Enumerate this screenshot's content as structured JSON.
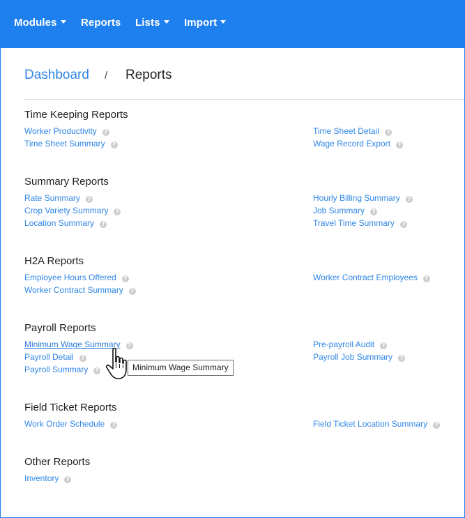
{
  "navbar": {
    "items": [
      {
        "label": "Modules",
        "dropdown": true
      },
      {
        "label": "Reports",
        "dropdown": false
      },
      {
        "label": "Lists",
        "dropdown": true
      },
      {
        "label": "Import",
        "dropdown": true
      }
    ]
  },
  "breadcrumb": {
    "home": "Dashboard",
    "separator": "/",
    "current": "Reports"
  },
  "sections": [
    {
      "title": "Time Keeping Reports",
      "left": [
        "Worker Productivity",
        "Time Sheet Summary"
      ],
      "right": [
        "Time Sheet Detail",
        "Wage Record Export"
      ]
    },
    {
      "title": "Summary Reports",
      "left": [
        "Rate Summary",
        "Crop Variety Summary",
        "Location Summary"
      ],
      "right": [
        "Hourly Billing Summary",
        "Job Summary",
        "Travel Time Summary"
      ]
    },
    {
      "title": "H2A Reports",
      "left": [
        "Employee Hours Offered",
        "Worker Contract Summary"
      ],
      "right": [
        "Worker Contract Employees"
      ]
    },
    {
      "title": "Payroll Reports",
      "left": [
        "Minimum Wage Summary",
        "Payroll Detail",
        "Payroll Summary"
      ],
      "right": [
        "Pre-payroll Audit",
        "Payroll Job Summary"
      ]
    },
    {
      "title": "Field Ticket Reports",
      "left": [
        "Work Order Schedule"
      ],
      "right": [
        "Field Ticket Location Summary"
      ]
    },
    {
      "title": "Other Reports",
      "left": [
        "Inventory"
      ],
      "right": []
    }
  ],
  "help_icon_glyph": "?",
  "tooltip": {
    "text": "Minimum Wage Summary"
  },
  "colors": {
    "navbar": "#1e7fef",
    "link": "#2f86e6",
    "help_icon": "#cdcdcd"
  }
}
